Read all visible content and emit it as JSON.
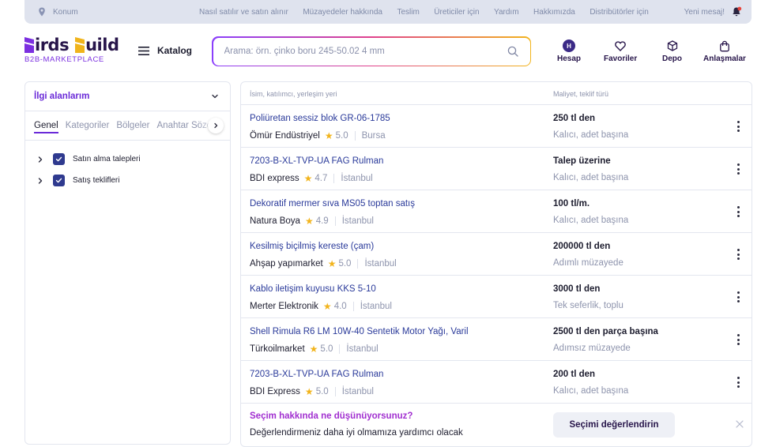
{
  "topbar": {
    "location": "Konum",
    "links": [
      "Nasıl satılır ve satın alınır",
      "Müzayedeler hakkında",
      "Teslim",
      "Üreticiler için",
      "Yardım",
      "Hakkımızda",
      "Distribütörler için"
    ],
    "new_message": "Yeni mesaj!"
  },
  "header": {
    "logo_part1": "irds",
    "logo_part2": "uild",
    "logo_tagline": "B2B-MARKETPLACE",
    "catalog": "Katalog",
    "search_placeholder": "Arama: örn. çinko boru 245-50.02 4 mm",
    "nav": {
      "account": "Hesap",
      "avatar_initial": "H",
      "favorites": "Favoriler",
      "warehouse": "Depo",
      "deals": "Anlaşmalar"
    }
  },
  "sidebar": {
    "title": "İlgi alanlarım",
    "tabs": [
      "Genel",
      "Kategoriler",
      "Bölgeler",
      "Anahtar Sözcükler"
    ],
    "tree": [
      {
        "label": "Satın alma talepleri",
        "checked": true
      },
      {
        "label": "Satış teklifleri",
        "checked": true
      }
    ]
  },
  "list": {
    "headers": {
      "col1": "İsim, katılımcı, yerleşim yeri",
      "col2": "Maliyet, teklif türü"
    },
    "rows": [
      {
        "title": "Poliüretan sessiz blok GR-06-1785",
        "seller": "Ömür Endüstriyel",
        "rating": "5.0",
        "city": "Bursa",
        "price": "250 tl den",
        "ptype": "Kalıcı, adet başına"
      },
      {
        "title": "7203-B-XL-TVP-UA FAG Rulman",
        "seller": "BDI express",
        "rating": "4.7",
        "city": "İstanbul",
        "price": "Talep üzerine",
        "ptype": "Kalıcı, adet başına"
      },
      {
        "title": "Dekoratif mermer sıva MS05 toptan satış",
        "seller": "Natura Boya",
        "rating": "4.9",
        "city": "İstanbul",
        "price": "100 tl/m.",
        "ptype": "Kalıcı, adet başına"
      },
      {
        "title": "Kesilmiş biçilmiş kereste (çam)",
        "seller": "Ahşap yapımarket",
        "rating": "5.0",
        "city": "İstanbul",
        "price": " 200000 tl den",
        "ptype": "Adımlı müzayede"
      },
      {
        "title": "Kablo iletişim kuyusu KKS 5-10",
        "seller": "Merter Elektronik",
        "rating": "4.0",
        "city": "İstanbul",
        "price": "3000 tl den",
        "ptype": "Tek seferlik, toplu"
      },
      {
        "title": "Shell Rimula R6 LM 10W-40 Sentetik Motor Yağı, Varil",
        "seller": "Türkoilmarket",
        "rating": "5.0",
        "city": "İstanbul",
        "price": "2500 tl den parça başına",
        "ptype": "Adımsız müzayede"
      },
      {
        "title": "7203-B-XL-TVP-UA FAG Rulman",
        "seller": "BDI Express",
        "rating": "5.0",
        "city": "İstanbul",
        "price": "200 tl den",
        "ptype": "Kalıcı, adet başına"
      }
    ],
    "feedback": {
      "question": "Seçim hakkında ne düşünüyorsunuz?",
      "subtitle": "Değerlendirmeniz daha iyi olmamıza yardımcı olacak",
      "button": "Seçimi değerlendirin"
    }
  },
  "colors": {
    "accent": "#6a2ad8",
    "link": "#2a3a9a",
    "star": "#f2b41c",
    "notify": "#e8453c"
  }
}
